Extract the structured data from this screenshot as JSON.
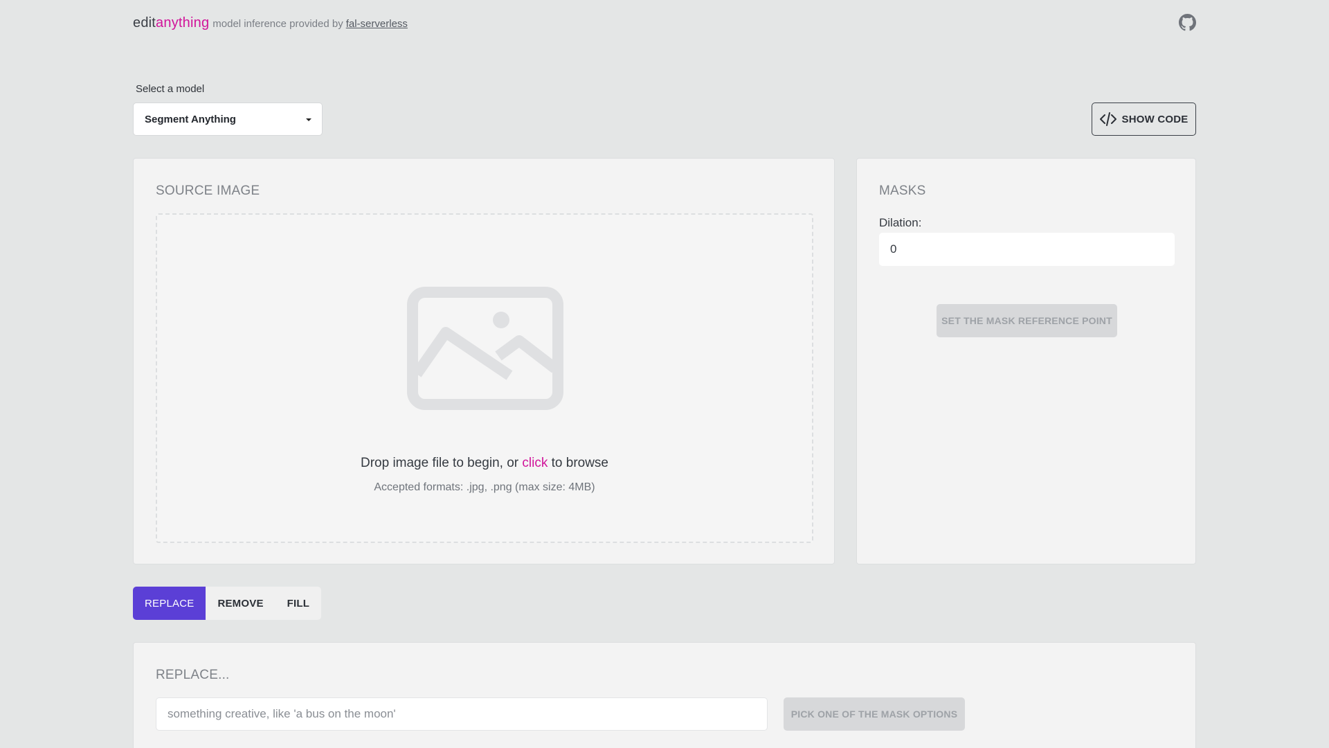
{
  "header": {
    "brand_prefix": "edit",
    "brand_accent": "anything",
    "tagline": "model inference provided by",
    "link_text": "fal-serverless",
    "github_icon": "github-icon"
  },
  "model_select": {
    "label": "Select a model",
    "selected": "Segment Anything"
  },
  "show_code": {
    "label": "SHOW CODE",
    "icon": "code-icon"
  },
  "source_image": {
    "title": "SOURCE IMAGE",
    "drop_text_before": "Drop image file to begin, or ",
    "drop_text_link": "click",
    "drop_text_after": " to browse",
    "accepted": "Accepted formats: .jpg, .png (max size: 4MB)",
    "placeholder_icon": "image-placeholder-icon"
  },
  "masks": {
    "title": "MASKS",
    "dilation_label": "Dilation:",
    "dilation_value": "0",
    "reference_button": "SET THE MASK REFERENCE POINT"
  },
  "tabs": [
    {
      "label": "REPLACE",
      "active": true
    },
    {
      "label": "REMOVE",
      "active": false
    },
    {
      "label": "FILL",
      "active": false
    }
  ],
  "replace": {
    "title": "REPLACE...",
    "placeholder": "something creative, like 'a bus on the moon'",
    "button": "PICK ONE OF THE MASK OPTIONS"
  },
  "colors": {
    "accent": "#d1149a",
    "primary": "#5b3fd6",
    "background": "#e4e6e6"
  }
}
